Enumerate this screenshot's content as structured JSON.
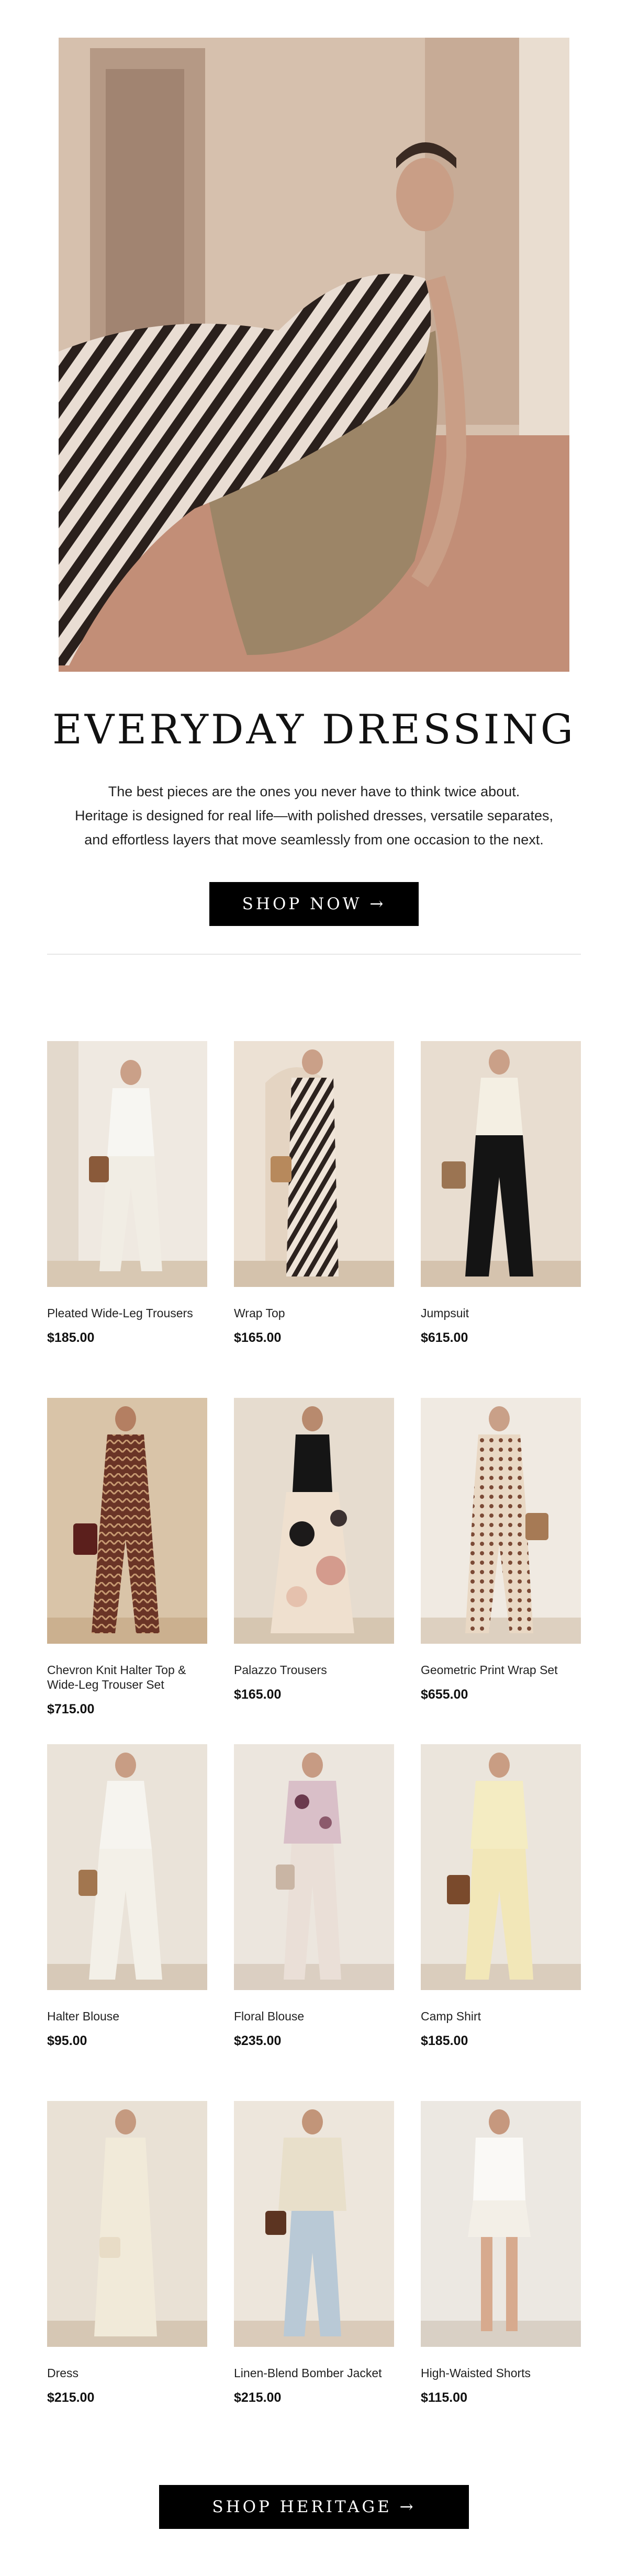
{
  "hero": {
    "headline": "EVERYDAY DRESSING",
    "intro_lines": [
      "The best pieces are the ones you never have to think twice about.",
      "Heritage is designed for real life—with polished dresses, versatile separates,",
      "and effortless layers that move seamlessly from one occasion to the next."
    ],
    "cta_label": "SHOP NOW →"
  },
  "products": [
    {
      "name": "Pleated Wide-Leg Trousers",
      "price": "$185.00"
    },
    {
      "name": "Wrap Top",
      "price": "$165.00"
    },
    {
      "name": "Jumpsuit",
      "price": "$615.00"
    },
    {
      "name": "Chevron Knit Halter Top & Wide-Leg Trouser Set",
      "price": "$715.00"
    },
    {
      "name": "Palazzo Trousers",
      "price": "$165.00"
    },
    {
      "name": "Geometric Print Wrap Set",
      "price": "$655.00"
    },
    {
      "name": "Halter Blouse",
      "price": "$95.00"
    },
    {
      "name": "Floral Blouse",
      "price": "$235.00"
    },
    {
      "name": "Camp Shirt",
      "price": "$185.00"
    },
    {
      "name": "Dress",
      "price": "$215.00"
    },
    {
      "name": "Linen-Blend Bomber Jacket",
      "price": "$215.00"
    },
    {
      "name": "High-Waisted Shorts",
      "price": "$115.00"
    }
  ],
  "footer": {
    "cta_label": "SHOP HERITAGE →"
  }
}
